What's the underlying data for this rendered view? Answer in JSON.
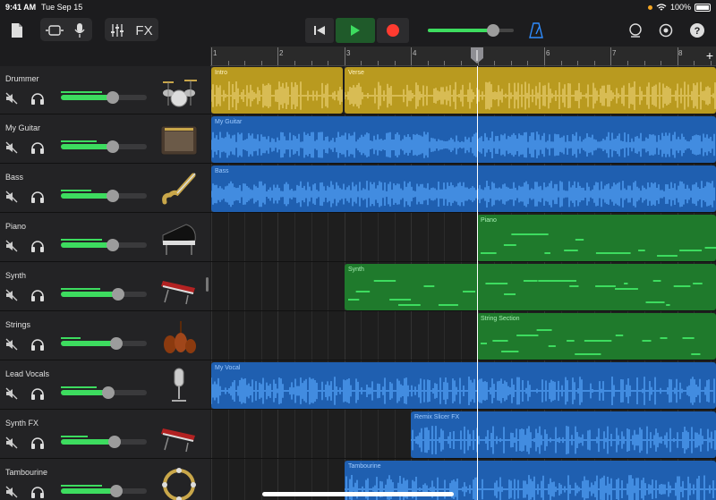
{
  "status": {
    "time": "9:41 AM",
    "date": "Tue Sep 15",
    "battery": "100%"
  },
  "toolbar": {
    "fx_label": "FX",
    "master_volume": 0.75
  },
  "ruler": {
    "bars": [
      "1",
      "2",
      "3",
      "4",
      "5",
      "6",
      "7",
      "8"
    ],
    "add_label": "+"
  },
  "tracks": [
    {
      "name": "Drummer",
      "volume": 0.6,
      "icon": "drum-kit-icon"
    },
    {
      "name": "My Guitar",
      "volume": 0.6,
      "icon": "guitar-amp-icon"
    },
    {
      "name": "Bass",
      "volume": 0.6,
      "icon": "bass-guitar-icon"
    },
    {
      "name": "Piano",
      "volume": 0.6,
      "icon": "grand-piano-icon"
    },
    {
      "name": "Synth",
      "volume": 0.66,
      "icon": "synth-keyboard-icon"
    },
    {
      "name": "Strings",
      "volume": 0.64,
      "icon": "violin-icon"
    },
    {
      "name": "Lead Vocals",
      "volume": 0.55,
      "icon": "microphone-icon"
    },
    {
      "name": "Synth FX",
      "volume": 0.62,
      "icon": "synth-keyboard-icon"
    },
    {
      "name": "Tambourine",
      "volume": 0.64,
      "icon": "tambourine-icon"
    }
  ],
  "regions": {
    "intro": "Intro",
    "verse": "Verse",
    "my_guitar": "My Guitar",
    "bass": "Bass",
    "piano": "Piano",
    "synth": "Synth",
    "string_section": "String Section",
    "my_vocal": "My Vocal",
    "remix_slicer": "Remix Slicer FX",
    "tambourine": "Tambourine"
  },
  "colors": {
    "drummer": "#b99a1f",
    "audio": "#1f5fb0",
    "midi": "#1f7a2c",
    "wave": "#4f9cf0",
    "accent": "#3ddc5f"
  }
}
